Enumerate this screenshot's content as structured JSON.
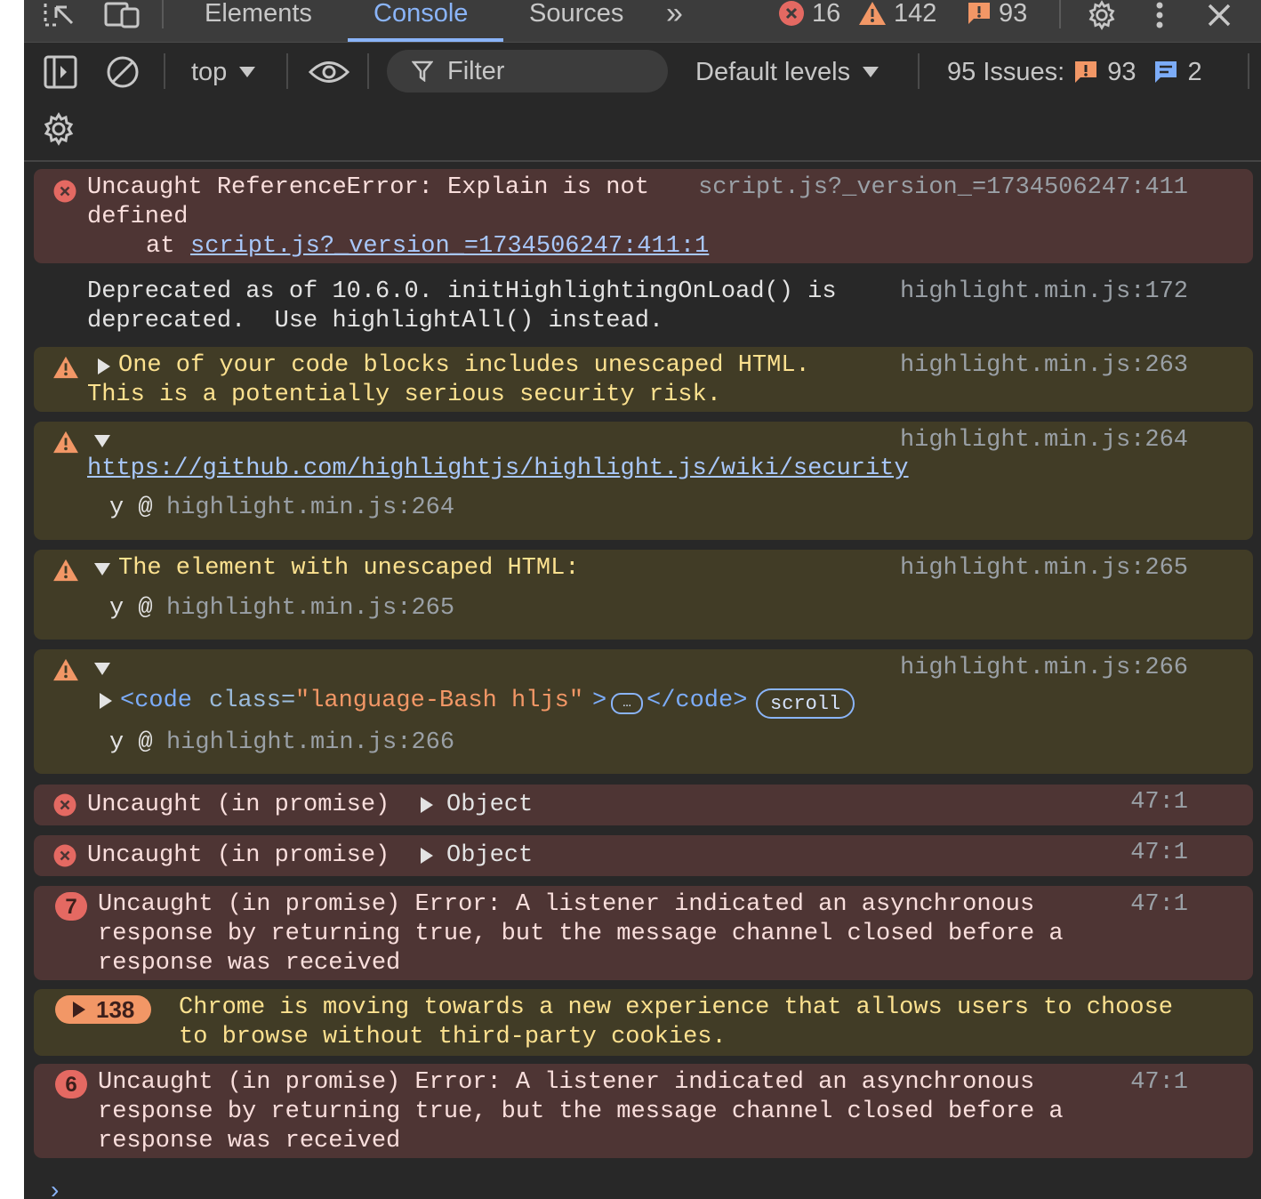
{
  "tabs": {
    "elements": "Elements",
    "console": "Console",
    "sources": "Sources",
    "more": "»"
  },
  "counts": {
    "errors": "16",
    "warnings": "142",
    "issues": "93"
  },
  "toolbar": {
    "context": "top",
    "filter_placeholder": "Filter",
    "levels": "Default levels",
    "issues_label": "95 Issues:",
    "issues_count": "93",
    "info_count": "2"
  },
  "messages": [
    {
      "level": "error",
      "text_line1": "Uncaught ReferenceError: Explain is not",
      "text_line2": "defined",
      "at_prefix": "at",
      "at_link": "script.js?_version_=1734506247:411:1",
      "source": "script.js?_version_=1734506247:411"
    },
    {
      "level": "info",
      "text_line1": "Deprecated as of 10.6.0. initHighlightingOnLoad() is",
      "text_line2": "deprecated.  Use highlightAll() instead.",
      "source": "highlight.min.js:172"
    },
    {
      "level": "warning",
      "text_line1": "One of your code blocks includes unescaped HTML.",
      "text_line2": "This is a potentially serious security risk.",
      "source": "highlight.min.js:263"
    },
    {
      "level": "warning",
      "link": "https://github.com/highlightjs/highlight.js/wiki/security",
      "stack_fn": "y @",
      "stack_src": "highlight.min.js:264",
      "source": "highlight.min.js:264"
    },
    {
      "level": "warning",
      "text_line1": "The element with unescaped HTML:",
      "stack_fn": "y @",
      "stack_src": "highlight.min.js:265",
      "source": "highlight.min.js:265"
    },
    {
      "level": "warning",
      "code_open_tag": "<code",
      "code_attr": "class=",
      "code_attr_value": "\"language-Bash hljs\"",
      "code_close_angle": ">",
      "code_ellipsis": "…",
      "code_end_tag": "</code>",
      "scroll_badge": "scroll",
      "stack_fn": "y @",
      "stack_src": "highlight.min.js:266",
      "source": "highlight.min.js:266"
    },
    {
      "level": "error",
      "text": "Uncaught (in promise)",
      "object": "Object",
      "source": "47:1"
    },
    {
      "level": "error",
      "text": "Uncaught (in promise)",
      "object": "Object",
      "source": "47:1"
    },
    {
      "level": "error",
      "repeat": "7",
      "text_line1": "Uncaught (in promise) Error: A listener indicated an asynchronous",
      "text_line2": "response by returning true, but the message channel closed before a",
      "text_line3": "response was received",
      "source": "47:1"
    },
    {
      "level": "warning",
      "repeat": "138",
      "text_line1": "Chrome is moving towards a new experience that allows users to choose",
      "text_line2": "to browse without third-party cookies."
    },
    {
      "level": "error",
      "repeat": "6",
      "text_line1": "Uncaught (in promise) Error: A listener indicated an asynchronous",
      "text_line2": "response by returning true, but the message channel closed before a",
      "text_line3": "response was received",
      "source": "47:1"
    }
  ],
  "prompt": "›",
  "colors": {
    "panel_bg": "#282828",
    "error_bg": "#4e3534",
    "warning_bg": "#413c26",
    "accent": "#8ab4f8",
    "error_icon": "#e46962",
    "warning_icon": "#f29766"
  }
}
